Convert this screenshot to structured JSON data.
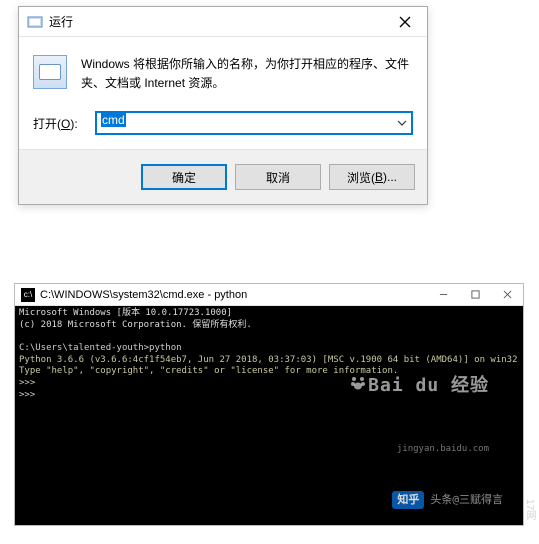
{
  "run_dialog": {
    "title": "运行",
    "description": "Windows 将根据你所输入的名称，为你打开相应的程序、文件夹、文档或 Internet 资源。",
    "open_label": "打开(O):",
    "input_value": "cmd",
    "buttons": {
      "ok": "确定",
      "cancel": "取消",
      "browse": "浏览(B)..."
    }
  },
  "console": {
    "title": "C:\\WINDOWS\\system32\\cmd.exe - python",
    "lines": {
      "l1": "Microsoft Windows [版本 10.0.17723.1000]",
      "l2": "(c) 2018 Microsoft Corporation. 保留所有权利.",
      "l3": "",
      "l4": "C:\\Users\\talented-youth>python",
      "l5": "Python 3.6.6 (v3.6.6:4cf1f54eb7, Jun 27 2018, 03:37:03) [MSC v.1900 64 bit (AMD64)] on win32",
      "l6": "Type \"help\", \"copyright\", \"credits\" or \"license\" for more information.",
      "l7": ">>>",
      "l8": ">>>"
    }
  },
  "watermarks": {
    "baidu_main": "Bai du 经验",
    "baidu_sub": "jingyan.baidu.com",
    "zhihu_logo": "知乎",
    "zhihu_text": "头条@三赋得言",
    "side": "17网"
  }
}
